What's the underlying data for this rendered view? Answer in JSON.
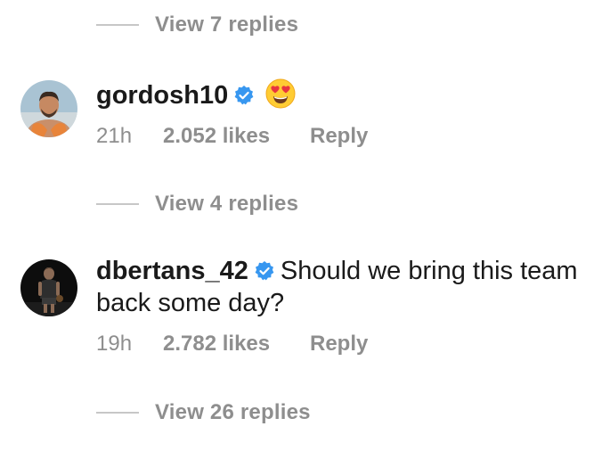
{
  "thread": [
    {
      "type": "view_replies",
      "label": "View 7 replies"
    },
    {
      "type": "comment",
      "username": "gordosh10",
      "verified": true,
      "text": "",
      "emoji": "heart-eyes-emoji",
      "time": "21h",
      "likes": "2.052 likes",
      "reply_label": "Reply"
    },
    {
      "type": "view_replies",
      "label": "View 4 replies"
    },
    {
      "type": "comment",
      "username": "dbertans_42",
      "verified": true,
      "text": "Should we bring this team back some day?",
      "time": "19h",
      "likes": "2.782 likes",
      "reply_label": "Reply"
    },
    {
      "type": "view_replies",
      "label": "View 26 replies"
    }
  ],
  "colors": {
    "secondary_text": "#8e8e8e",
    "primary_text": "#1a1a1a",
    "verified_badge": "#3797f0",
    "divider_line": "#c7c7c7"
  },
  "icons": {
    "verified": "verified-badge-icon",
    "emoji": "heart-eyes-emoji"
  }
}
